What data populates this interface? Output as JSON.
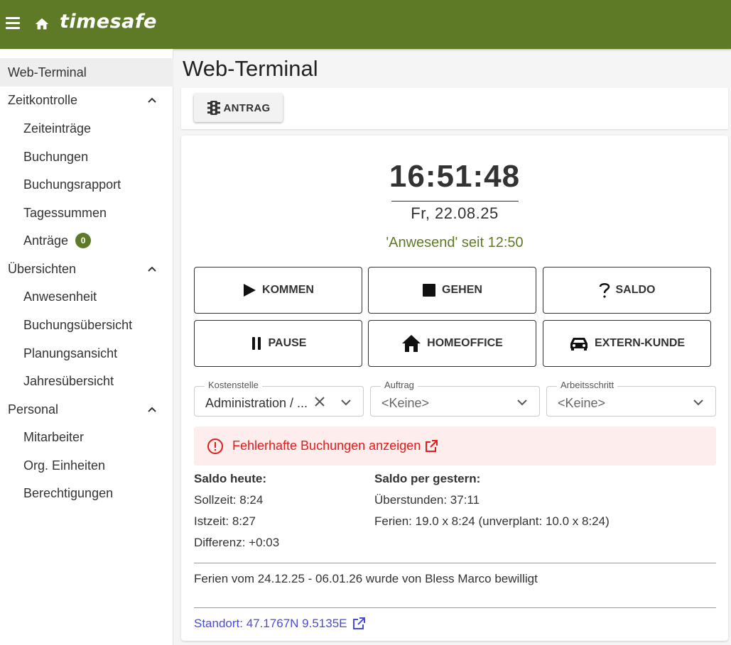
{
  "app": {
    "logo": "timesafe",
    "menu_icon": "menu-icon",
    "home_icon": "home-icon",
    "brand_color": "#5f7a27"
  },
  "sidebar": {
    "web_terminal": "Web-Terminal",
    "zeitkontrolle": "Zeitkontrolle",
    "zeiteintraege": "Zeiteinträge",
    "buchungen": "Buchungen",
    "buchungsrapport": "Buchungsrapport",
    "tagessummen": "Tagessummen",
    "antraege": "Anträge",
    "antraege_badge": "0",
    "uebersichten": "Übersichten",
    "anwesenheit": "Anwesenheit",
    "buchungsuebersicht": "Buchungsübersicht",
    "planungsansicht": "Planungsansicht",
    "jahresuebersicht": "Jahresübersicht",
    "personal": "Personal",
    "mitarbeiter": "Mitarbeiter",
    "org_einheiten": "Org. Einheiten",
    "berechtigungen": "Berechtigungen"
  },
  "main": {
    "title": "Web-Terminal",
    "antrag_button": "ANTRAG",
    "clock": "16:51:48",
    "date": "Fr, 22.08.25",
    "status": "'Anwesend' seit 12:50",
    "buttons": {
      "kommen": "KOMMEN",
      "gehen": "GEHEN",
      "saldo": "SALDO",
      "pause": "PAUSE",
      "homeoffice": "HOMEOFFICE",
      "extern": "EXTERN-KUNDE"
    },
    "fields": {
      "kostenstelle_label": "Kostenstelle",
      "kostenstelle_value": "Administration / ...",
      "auftrag_label": "Auftrag",
      "auftrag_value": "<Keine>",
      "arbeitsschritt_label": "Arbeitsschritt",
      "arbeitsschritt_value": "<Keine>"
    },
    "alert": "Fehlerhafte Buchungen anzeigen",
    "saldo_heute": {
      "heading": "Saldo heute:",
      "sollzeit": "Sollzeit: 8:24",
      "istzeit": "Istzeit: 8:27",
      "differenz": "Differenz: +0:03"
    },
    "saldo_gestern": {
      "heading": "Saldo per gestern:",
      "ueberstunden": "Überstunden: 37:11",
      "ferien": "Ferien: 19.0 x 8:24 (unverplant: 10.0 x 8:24)"
    },
    "message": "Ferien vom 24.12.25 - 06.01.26 wurde von Bless Marco bewilligt",
    "standort": "Standort: 47.1767N 9.5135E"
  }
}
